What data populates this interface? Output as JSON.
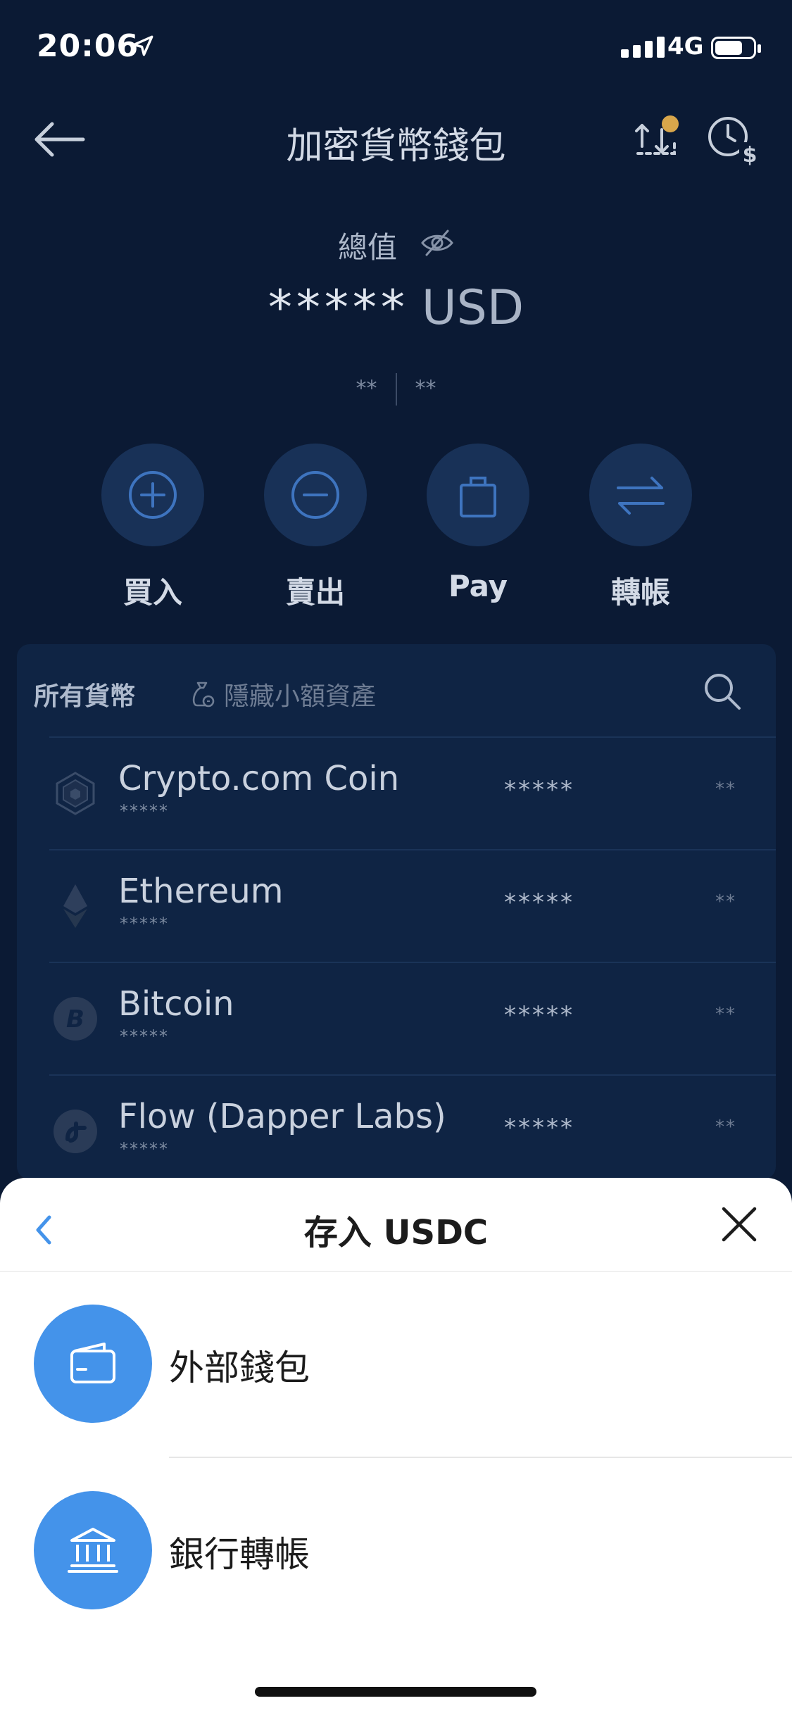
{
  "status_bar": {
    "time": "20:06",
    "network": "4G"
  },
  "header": {
    "title": "加密貨幣錢包"
  },
  "balance": {
    "label": "總值",
    "masked_value": "*****",
    "currency": "USD",
    "change_left": "**",
    "change_right": "**"
  },
  "actions": [
    {
      "label": "買入",
      "icon": "plus-circle-icon"
    },
    {
      "label": "賣出",
      "icon": "minus-circle-icon"
    },
    {
      "label": "Pay",
      "icon": "shopping-bag-icon"
    },
    {
      "label": "轉帳",
      "icon": "transfer-arrows-icon"
    }
  ],
  "currency_list": {
    "tab_all": "所有貨幣",
    "hide_small": "隱藏小額資產",
    "items": [
      {
        "name": "Crypto.com Coin",
        "sub": "*****",
        "amount": "*****",
        "change": "**"
      },
      {
        "name": "Ethereum",
        "sub": "*****",
        "amount": "*****",
        "change": "**"
      },
      {
        "name": "Bitcoin",
        "sub": "*****",
        "amount": "*****",
        "change": "**"
      },
      {
        "name": "Flow (Dapper Labs)",
        "sub": "*****",
        "amount": "*****",
        "change": "**"
      }
    ]
  },
  "sheet": {
    "title": "存入 USDC",
    "options": [
      {
        "label": "外部錢包",
        "icon": "wallet-icon"
      },
      {
        "label": "銀行轉帳",
        "icon": "bank-icon"
      }
    ]
  },
  "colors": {
    "background": "#0b1a34",
    "accent": "#4493ea",
    "sheet": "#ffffff"
  }
}
